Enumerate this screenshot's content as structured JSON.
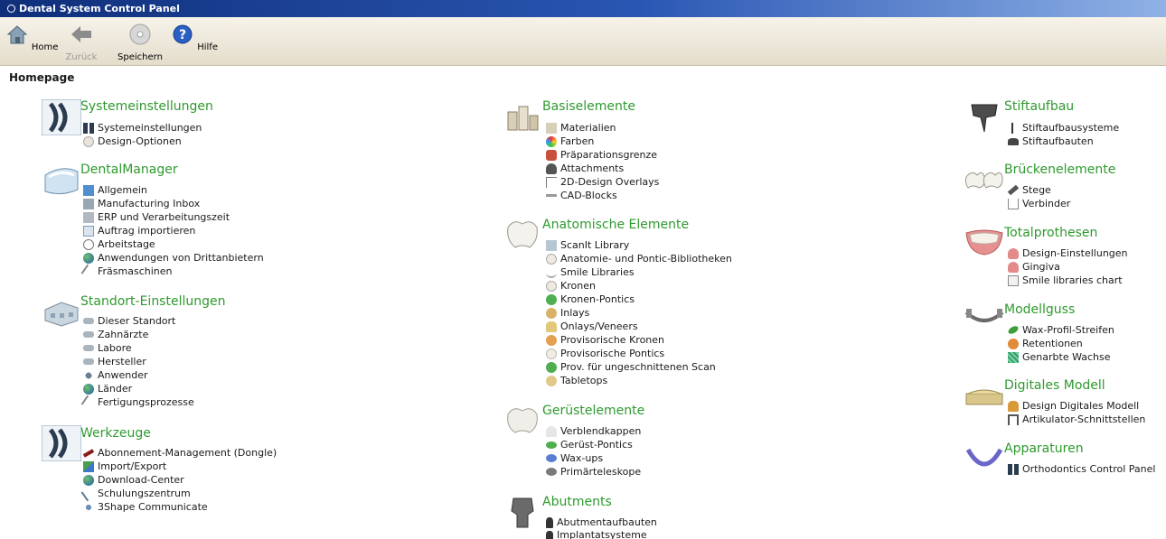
{
  "window": {
    "title": "Dental System Control Panel"
  },
  "toolbar": {
    "home": "Home",
    "back": "Zurück",
    "save": "Speichern",
    "help": "Hilfe"
  },
  "page": {
    "label": "Homepage"
  },
  "col1": {
    "systemeinstellungen": {
      "title": "Systemeinstellungen",
      "items": [
        "Systemeinstellungen",
        "Design-Optionen"
      ]
    },
    "dentalmanager": {
      "title": "DentalManager",
      "items": [
        "Allgemein",
        "Manufacturing Inbox",
        "ERP und Verarbeitungszeit",
        "Auftrag importieren",
        "Arbeitstage",
        "Anwendungen von Drittanbietern",
        "Fräsmaschinen"
      ]
    },
    "standort": {
      "title": "Standort-Einstellungen",
      "items": [
        "Dieser Standort",
        "Zahnärzte",
        "Labore",
        "Hersteller",
        "Anwender",
        "Länder",
        "Fertigungsprozesse"
      ]
    },
    "werkzeuge": {
      "title": "Werkzeuge",
      "items": [
        "Abonnement-Management (Dongle)",
        "Import/Export",
        "Download-Center",
        "Schulungszentrum",
        "3Shape Communicate"
      ]
    }
  },
  "col2": {
    "basiselemente": {
      "title": "Basiselemente",
      "items": [
        "Materialien",
        "Farben",
        "Präparationsgrenze",
        "Attachments",
        "2D-Design Overlays",
        "CAD-Blocks"
      ]
    },
    "anatomische": {
      "title": "Anatomische Elemente",
      "items": [
        "ScanIt Library",
        "Anatomie- und Pontic-Bibliotheken",
        "Smile Libraries",
        "Kronen",
        "Kronen-Pontics",
        "Inlays",
        "Onlays/Veneers",
        "Provisorische Kronen",
        "Provisorische Pontics",
        "Prov. für ungeschnittenen Scan",
        "Tabletops"
      ]
    },
    "geruest": {
      "title": "Gerüstelemente",
      "items": [
        "Verblendkappen",
        "Gerüst-Pontics",
        "Wax-ups",
        "Primärteleskope"
      ]
    },
    "abutments": {
      "title": "Abutments",
      "items": [
        "Abutmentaufbauten",
        "Implantatsysteme"
      ]
    }
  },
  "col3": {
    "stiftaufbau": {
      "title": "Stiftaufbau",
      "items": [
        "Stiftaufbausysteme",
        "Stiftaufbauten"
      ]
    },
    "bruecken": {
      "title": "Brückenelemente",
      "items": [
        "Stege",
        "Verbinder"
      ]
    },
    "totalprothesen": {
      "title": "Totalprothesen",
      "items": [
        "Design-Einstellungen",
        "Gingiva",
        "Smile libraries chart"
      ]
    },
    "modellguss": {
      "title": "Modellguss",
      "items": [
        "Wax-Profil-Streifen",
        "Retentionen",
        "Genarbte Wachse"
      ]
    },
    "digitales": {
      "title": "Digitales Modell",
      "items": [
        "Design Digitales Modell",
        "Artikulator-Schnittstellen"
      ]
    },
    "apparaturen": {
      "title": "Apparaturen",
      "items": [
        "Orthodontics Control Panel"
      ]
    }
  }
}
